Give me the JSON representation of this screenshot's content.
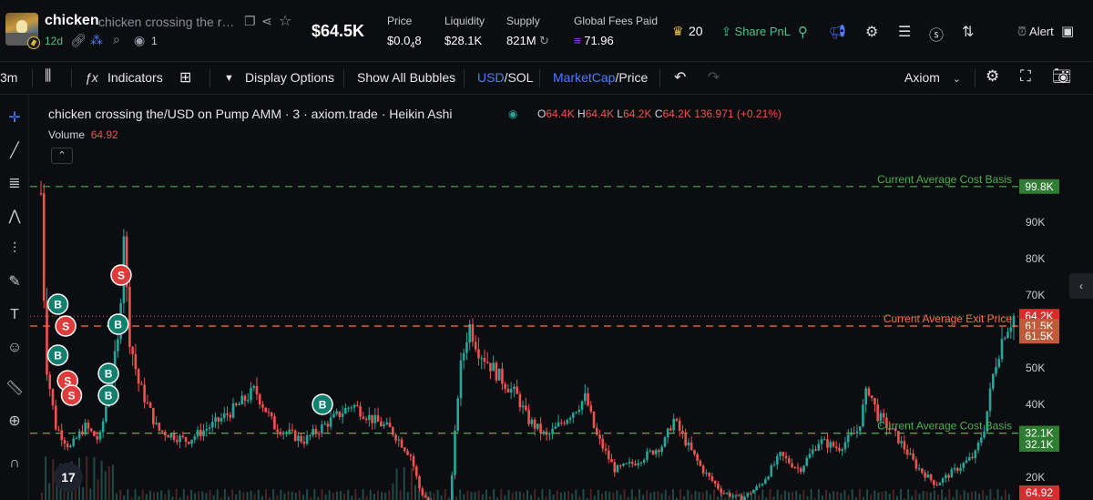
{
  "token": {
    "symbol": "chicken",
    "name": "chicken crossing the road",
    "age": "12d",
    "views": "1"
  },
  "header": {
    "market_cap": "$64.5K",
    "price_label": "Price",
    "price_main": "$0.0",
    "price_sub": "4",
    "price_tail": "8",
    "liquidity_label": "Liquidity",
    "liquidity_value": "$28.1K",
    "supply_label": "Supply",
    "supply_value": "821M",
    "fees_label": "Global Fees Paid",
    "fees_value": "71.96",
    "crown_count": "20",
    "share_label": "Share PnL",
    "alert_label": "Alert"
  },
  "toolbar": {
    "interval": "3m",
    "indicators": "Indicators",
    "display_options": "Display Options",
    "show_all_bubbles": "Show All Bubbles",
    "currency_a": "USD",
    "currency_b": "/SOL",
    "metric_a": "MarketCap",
    "metric_b": "/Price",
    "source": "Axiom"
  },
  "chart_legend": {
    "title": "chicken crossing the/USD on Pump AMM · 3 · axiom.trade · Heikin Ashi",
    "o_key": "O",
    "o_val": "64.4K",
    "h_key": "H",
    "h_val": "64.4K",
    "l_key": "L",
    "l_val": "64.2K",
    "c_key": "C",
    "c_val": "64.2K",
    "change": "136.971 (+0.21%)",
    "volume_label": "Volume",
    "volume_value": "64.92"
  },
  "colors": {
    "up": "#26a69a",
    "down": "#ef5350",
    "cost_basis": "#4caf50",
    "exit_price": "#ff7043",
    "accent_blue": "#4e7cff"
  },
  "chart_data": {
    "type": "candlestick",
    "style": "Heikin Ashi",
    "y_axis_ticks": [
      "90K",
      "80K",
      "70K",
      "50K",
      "40K",
      "20K",
      "10K"
    ],
    "y_range": [
      0,
      104000
    ],
    "price_lines": [
      {
        "label": "Current Average Cost Basis",
        "value": 99800,
        "tag": "99.8K",
        "color": "#4caf50"
      },
      {
        "label": "Current Average Exit Price",
        "value": 61500,
        "tag": "61.5K",
        "color": "#ff7043"
      },
      {
        "label": "Current Average Cost Basis",
        "value": 32100,
        "tag": "32.1K",
        "color": "#4caf50"
      }
    ],
    "axis_tags": [
      {
        "text": "64.2K",
        "value": 64200,
        "kind": "down"
      },
      {
        "text": "61.5K",
        "value": 61500,
        "kind": "exit"
      },
      {
        "text": "61.5K",
        "value": 58700,
        "kind": "exit"
      },
      {
        "text": "32.1K",
        "value": 32100,
        "kind": "cost"
      },
      {
        "text": "32.1K",
        "value": 29000,
        "kind": "cost"
      },
      {
        "text": "64.92",
        "value": 1000,
        "kind": "down"
      }
    ],
    "path_points": [
      [
        0,
        98000
      ],
      [
        0.5,
        52000
      ],
      [
        1.5,
        34000
      ],
      [
        3,
        28000
      ],
      [
        4.5,
        34000
      ],
      [
        6,
        30000
      ],
      [
        7,
        44000
      ],
      [
        8,
        58000
      ],
      [
        8.5,
        89000
      ],
      [
        9,
        60000
      ],
      [
        10,
        46000
      ],
      [
        12,
        33000
      ],
      [
        15,
        30000
      ],
      [
        18,
        35000
      ],
      [
        20,
        39000
      ],
      [
        22,
        44000
      ],
      [
        24,
        34000
      ],
      [
        27,
        30000
      ],
      [
        30,
        36000
      ],
      [
        32,
        40000
      ],
      [
        34,
        36000
      ],
      [
        36,
        33000
      ],
      [
        38,
        26000
      ],
      [
        39,
        16000
      ],
      [
        40,
        13000
      ],
      [
        41,
        10500
      ],
      [
        42,
        11000
      ],
      [
        43,
        48000
      ],
      [
        44,
        62000
      ],
      [
        45,
        55000
      ],
      [
        47,
        48000
      ],
      [
        49,
        42000
      ],
      [
        50,
        36000
      ],
      [
        52,
        31000
      ],
      [
        55,
        39000
      ],
      [
        56,
        42000
      ],
      [
        57,
        32000
      ],
      [
        59,
        22000
      ],
      [
        61,
        24000
      ],
      [
        64,
        29000
      ],
      [
        65,
        36000
      ],
      [
        66,
        31000
      ],
      [
        68,
        22000
      ],
      [
        70,
        16000
      ],
      [
        72,
        14000
      ],
      [
        74,
        18000
      ],
      [
        76,
        26000
      ],
      [
        78,
        22000
      ],
      [
        80,
        30000
      ],
      [
        82,
        28000
      ],
      [
        84,
        33000
      ],
      [
        85,
        45000
      ],
      [
        86,
        37000
      ],
      [
        88,
        31000
      ],
      [
        90,
        23000
      ],
      [
        92,
        18000
      ],
      [
        94,
        22000
      ],
      [
        96,
        26000
      ],
      [
        97,
        34000
      ],
      [
        98,
        50000
      ],
      [
        99,
        60000
      ],
      [
        100,
        64200
      ]
    ],
    "trade_markers": [
      {
        "side": "B",
        "x": 0.8,
        "value": 67500
      },
      {
        "side": "S",
        "x": 1.6,
        "value": 61500
      },
      {
        "side": "B",
        "x": 0.8,
        "value": 53500
      },
      {
        "side": "S",
        "x": 1.8,
        "value": 46500
      },
      {
        "side": "S",
        "x": 2.2,
        "value": 42500
      },
      {
        "side": "B",
        "x": 6.0,
        "value": 48500
      },
      {
        "side": "B",
        "x": 6.0,
        "value": 42500
      },
      {
        "side": "B",
        "x": 7.0,
        "value": 62000
      },
      {
        "side": "S",
        "x": 7.3,
        "value": 75500
      },
      {
        "side": "B",
        "x": 28.0,
        "value": 40000
      }
    ]
  }
}
